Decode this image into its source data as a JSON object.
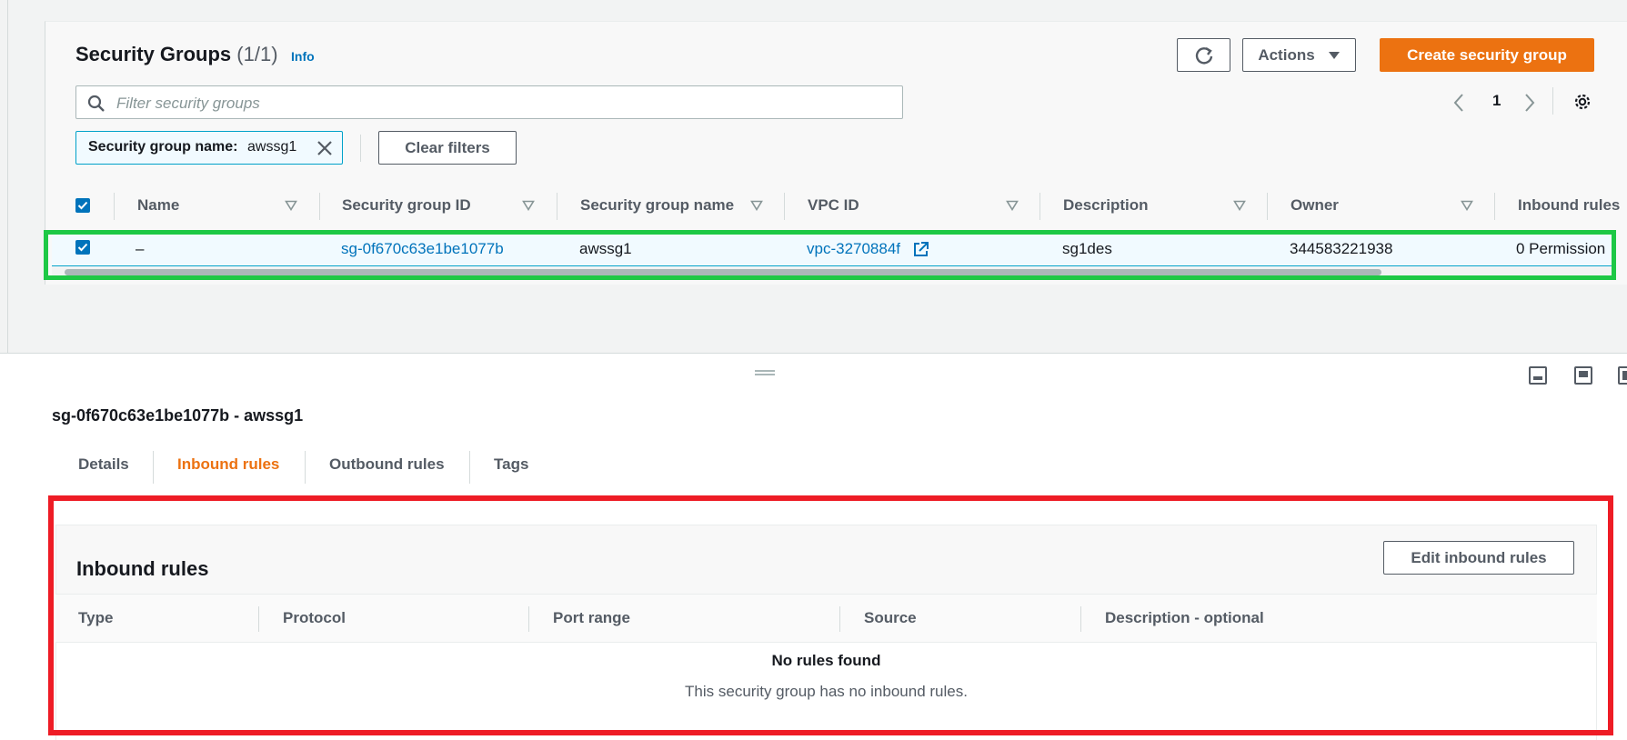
{
  "header": {
    "title": "Security Groups",
    "count": "(1/1)",
    "info_link": "Info",
    "refresh_icon": "refresh-icon",
    "actions_label": "Actions",
    "create_label": "Create security group"
  },
  "filter": {
    "placeholder": "Filter security groups",
    "token_label": "Security group name:",
    "token_value": "awssg1",
    "clear_label": "Clear filters"
  },
  "pagination": {
    "page": "1"
  },
  "table": {
    "columns": [
      "Name",
      "Security group ID",
      "Security group name",
      "VPC ID",
      "Description",
      "Owner",
      "Inbound rules"
    ],
    "rows": [
      {
        "name": "–",
        "sg_id": "sg-0f670c63e1be1077b",
        "sg_name": "awssg1",
        "vpc_id": "vpc-3270884f",
        "description": "sg1des",
        "owner": "344583221938",
        "inbound": "0 Permission"
      }
    ]
  },
  "details": {
    "title": "sg-0f670c63e1be1077b - awssg1",
    "tabs": [
      "Details",
      "Inbound rules",
      "Outbound rules",
      "Tags"
    ],
    "active_tab": "Inbound rules"
  },
  "inbound": {
    "title": "Inbound rules",
    "edit_label": "Edit inbound rules",
    "columns": [
      "Type",
      "Protocol",
      "Port range",
      "Source",
      "Description - optional"
    ],
    "empty_title": "No rules found",
    "empty_text": "This security group has no inbound rules."
  },
  "colors": {
    "accent": "#ec7211",
    "link": "#0073bb",
    "highlight_green": "#1ec845",
    "highlight_red": "#ee1c25"
  }
}
